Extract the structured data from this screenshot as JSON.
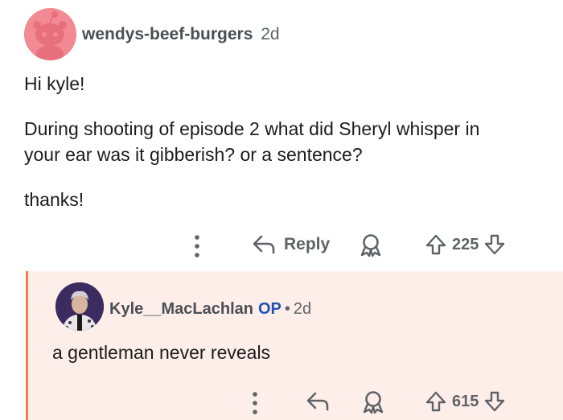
{
  "comment": {
    "username": "wendys-beef-burgers",
    "age": "2d",
    "body": {
      "line1": "Hi kyle!",
      "line2": "During shooting of episode 2 what did Sheryl whisper in",
      "line3": "your ear was it gibberish? or a sentence?",
      "line4": "thanks!"
    },
    "actions": {
      "reply_label": "Reply",
      "upvotes": "225"
    }
  },
  "reply": {
    "username": "Kyle__MacLachlan",
    "op_badge": "OP",
    "separator": "•",
    "age": "2d",
    "body": "a gentleman never reveals",
    "actions": {
      "upvotes": "615"
    }
  },
  "colors": {
    "reply_background": "#fdeeea",
    "thread_line": "#ff7a45",
    "op_badge": "#1f52b0",
    "avatar_snoo_bg": "#f28a94"
  },
  "icons": [
    "more-options-icon",
    "reply-arrow-icon",
    "award-icon",
    "upvote-icon",
    "downvote-icon"
  ]
}
